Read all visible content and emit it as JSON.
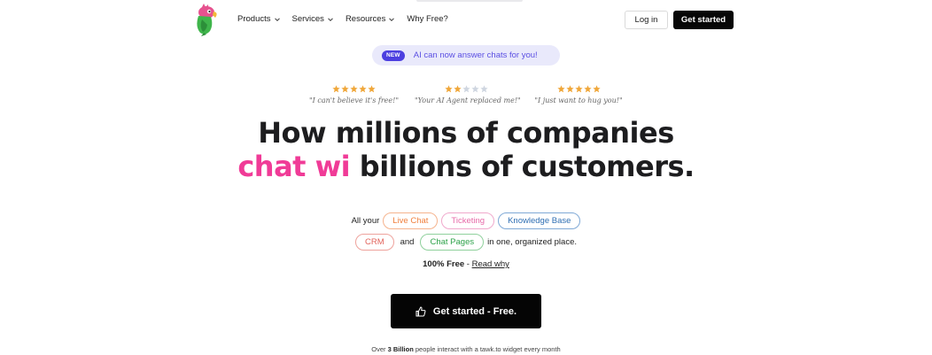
{
  "nav": {
    "menu": [
      {
        "label": "Products",
        "has_dropdown": true
      },
      {
        "label": "Services",
        "has_dropdown": true
      },
      {
        "label": "Resources",
        "has_dropdown": true
      },
      {
        "label": "Why Free?",
        "has_dropdown": false
      }
    ],
    "login_label": "Log in",
    "get_started_label": "Get started"
  },
  "announce": {
    "badge": "NEW",
    "text": "AI can now answer chats for you!"
  },
  "reviews": [
    {
      "rating": 5,
      "quote": "\"I can't believe it's free!\""
    },
    {
      "rating": 2,
      "quote": "\"Your AI Agent replaced me!\""
    },
    {
      "rating": 5,
      "quote": "\"I just want to hug you!\""
    }
  ],
  "hero": {
    "line1": "How millions of companies",
    "line2_highlight": "chat wi",
    "line2_rest": " billions of customers."
  },
  "features": {
    "prefix": "All your",
    "chip_live_chat": "Live Chat",
    "chip_ticketing": "Ticketing",
    "chip_knowledge_base": "Knowledge Base",
    "chip_crm": "CRM",
    "and": "and",
    "chip_chat_pages": "Chat Pages",
    "suffix": "in one, organized place."
  },
  "free_line": {
    "bold": "100% Free",
    "sep": " - ",
    "link": "Read why"
  },
  "cta": {
    "label": "Get started - Free."
  },
  "bottom_note": {
    "before": "Over ",
    "bold": "3 Billion",
    "after": " people interact with a tawk.to widget every month"
  },
  "colors": {
    "accent_pink": "#f03b97",
    "new_badge": "#4c3fe0",
    "star_gold": "#f0a73a",
    "star_gray": "#cfd6e0"
  }
}
